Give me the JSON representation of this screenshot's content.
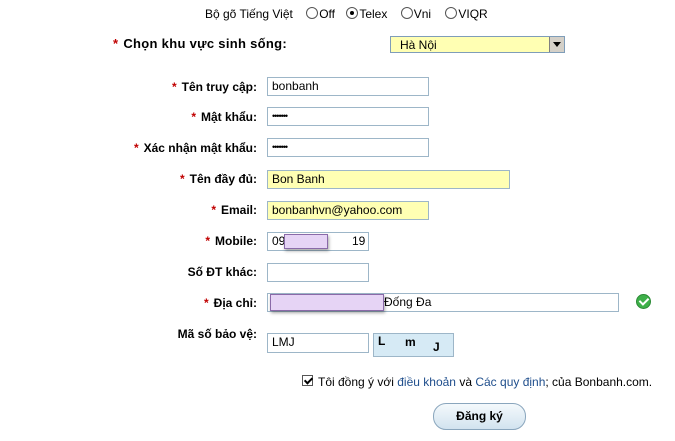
{
  "keyboard": {
    "label": "Bộ gõ Tiếng Việt",
    "options": [
      {
        "label": "Off",
        "selected": false
      },
      {
        "label": "Telex",
        "selected": true
      },
      {
        "label": "Vni",
        "selected": false
      },
      {
        "label": "VIQR",
        "selected": false
      }
    ]
  },
  "region": {
    "label": "Chọn khu vực sinh sống:",
    "value": "Hà Nội"
  },
  "form": {
    "username": {
      "label": "Tên truy cập:",
      "value": "bonbanh"
    },
    "password": {
      "label": "Mật khẩu:",
      "value": "•••••••"
    },
    "confirm": {
      "label": "Xác nhận mật khẩu:",
      "value": "•••••••"
    },
    "fullname": {
      "label": "Tên đầy đủ:",
      "value": "Bon Banh"
    },
    "email": {
      "label": "Email:",
      "value": "bonbanhvn@yahoo.com"
    },
    "mobile": {
      "label": "Mobile:",
      "value_start": "09",
      "value_end": "19"
    },
    "other_phone": {
      "label": "Số ĐT khác:",
      "value": ""
    },
    "address": {
      "label": "Địa chỉ:",
      "value_end": "Đống Đa"
    },
    "captcha": {
      "label": "Mã số bảo vệ:",
      "value": "LMJ",
      "image_chars": [
        "L",
        "m",
        "J"
      ]
    }
  },
  "agree": {
    "prefix": "Tôi đồng ý với",
    "terms_link": "điều khoản",
    "and": "và",
    "rules_link": "Các quy định",
    "suffix": "; của Bonbanh.com."
  },
  "submit_label": "Đăng ký",
  "colors": {
    "required": "#c00000",
    "highlight_field": "#ffffb3",
    "link": "#1f4e8c"
  }
}
